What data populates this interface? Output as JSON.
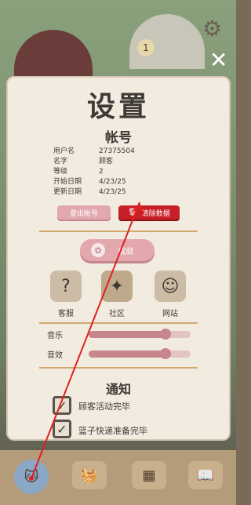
{
  "hud": {
    "sign_text": "1",
    "close_glyph": "✕",
    "gear_glyph": "⚙"
  },
  "settings": {
    "title": "设置",
    "account": {
      "heading": "帐号",
      "rows": [
        {
          "key": "用户名",
          "value": "27375504"
        },
        {
          "key": "名字",
          "value": "顾客"
        },
        {
          "key": "等级",
          "value": "2"
        },
        {
          "key": "开始日期",
          "value": "4/23/25"
        },
        {
          "key": "更新日期",
          "value": "4/23/25"
        }
      ],
      "logout_label": "登出帐号",
      "clear_label": "清除数据",
      "clear_icon": "trash-icon"
    },
    "achievements_label": "成就",
    "links": [
      {
        "label": "客服",
        "icon": "question-icon",
        "glyph": "?"
      },
      {
        "label": "社区",
        "icon": "community-icon",
        "glyph": "✦"
      },
      {
        "label": "网站",
        "icon": "website-icon",
        "glyph": "☺"
      }
    ],
    "audio": {
      "music_label": "音乐",
      "sfx_label": "音效",
      "music_level": 0.75,
      "sfx_level": 0.75
    },
    "notifications": {
      "heading": "通知",
      "items": [
        {
          "label": "顾客活动完毕",
          "checked": true
        },
        {
          "label": "篮子快递准备完毕",
          "checked": true
        }
      ]
    }
  },
  "bottom_bar": {
    "slots": [
      "cat-icon",
      "basket-icon",
      "rug-icon",
      "book-icon"
    ]
  },
  "colors": {
    "accent_pink": "#e2a8ad",
    "danger_red": "#c81e26",
    "panel_bg": "#f2ebe0",
    "divider_gold": "#d0a86f",
    "annotation_red": "#e02020"
  }
}
